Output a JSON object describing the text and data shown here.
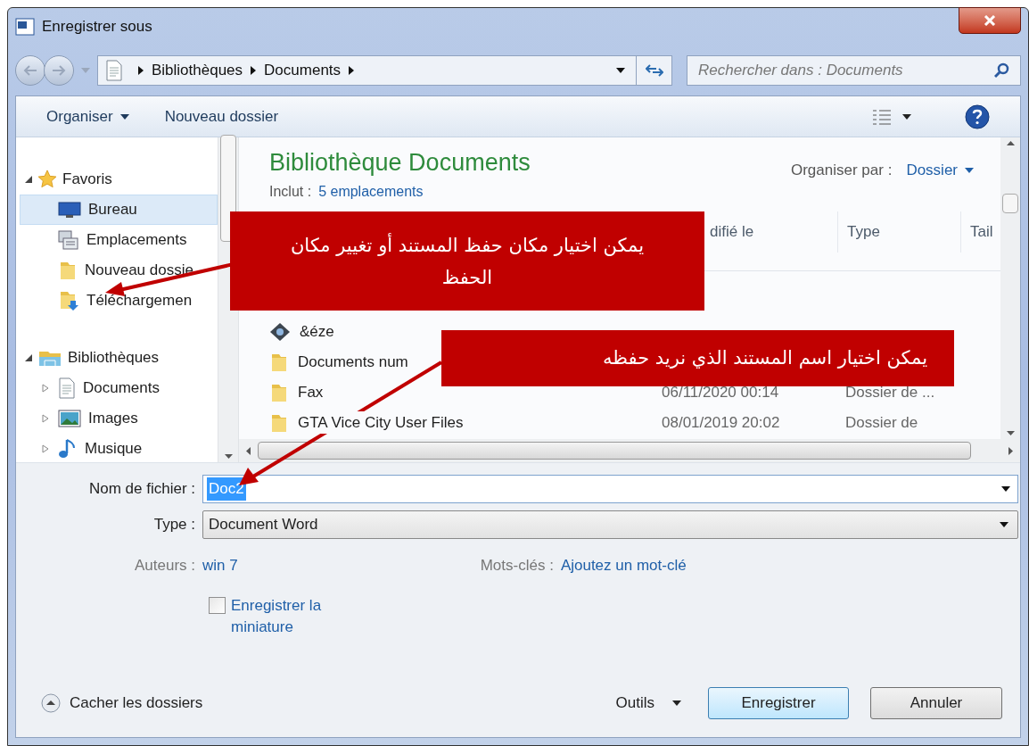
{
  "window": {
    "title": "Enregistrer sous"
  },
  "address": {
    "crumbs": [
      "Bibliothèques",
      "Documents"
    ]
  },
  "search": {
    "placeholder": "Rechercher dans : Documents"
  },
  "toolbar": {
    "organize": "Organiser",
    "new_folder": "Nouveau dossier"
  },
  "sidebar": {
    "groups": [
      {
        "label": "Favoris",
        "kind": "star",
        "expanded": true,
        "children": [
          {
            "label": "Bureau",
            "kind": "desktop",
            "selected": true,
            "expandable": false
          },
          {
            "label": "Emplacements",
            "kind": "places",
            "selected": false,
            "expandable": false
          },
          {
            "label": "Nouveau dossie",
            "kind": "folder",
            "selected": false,
            "expandable": false
          },
          {
            "label": "Téléchargemen",
            "kind": "download",
            "selected": false,
            "expandable": false
          }
        ]
      },
      {
        "label": "Bibliothèques",
        "kind": "library",
        "expanded": true,
        "children": [
          {
            "label": "Documents",
            "kind": "document",
            "selected": false,
            "expandable": true
          },
          {
            "label": "Images",
            "kind": "images",
            "selected": false,
            "expandable": true
          },
          {
            "label": "Musique",
            "kind": "music",
            "selected": false,
            "expandable": true
          }
        ]
      }
    ]
  },
  "library": {
    "title": "Bibliothèque Documents",
    "includes_label": "Inclut :",
    "includes_link": "5 emplacements",
    "arrange_label": "Organiser par :",
    "arrange_value": "Dossier"
  },
  "table": {
    "columns": [
      "difié le",
      "Type",
      "Tail"
    ],
    "rows": [
      {
        "name": "&éze",
        "kind": "shortcut"
      },
      {
        "name": "Documents num",
        "kind": "folder"
      },
      {
        "name": "Fax",
        "date": "06/11/2020 00:14",
        "type": "Dossier de ...",
        "kind": "folder"
      },
      {
        "name": "GTA Vice City User Files",
        "date": "08/01/2019 20:02",
        "type": "Dossier de",
        "kind": "folder"
      }
    ]
  },
  "form": {
    "filename_label": "Nom de fichier :",
    "filename": "Doc2",
    "filename_selected": true,
    "type_label": "Type :",
    "type": "Document Word",
    "authors_label": "Auteurs :",
    "authors": "win 7",
    "tags_label": "Mots-clés :",
    "tags": "Ajoutez un mot-clé",
    "thumbnail": {
      "label": "Enregistrer la miniature",
      "checked": false
    }
  },
  "footer": {
    "hide_folders": "Cacher les dossiers",
    "tools": "Outils",
    "save": "Enregistrer",
    "cancel": "Annuler"
  },
  "callouts": [
    "يمكن اختيار مكان حفظ المستند أو تغيير مكان الحفظ",
    "يمكن اختيار اسم المستند الذي نريد حفظه"
  ]
}
